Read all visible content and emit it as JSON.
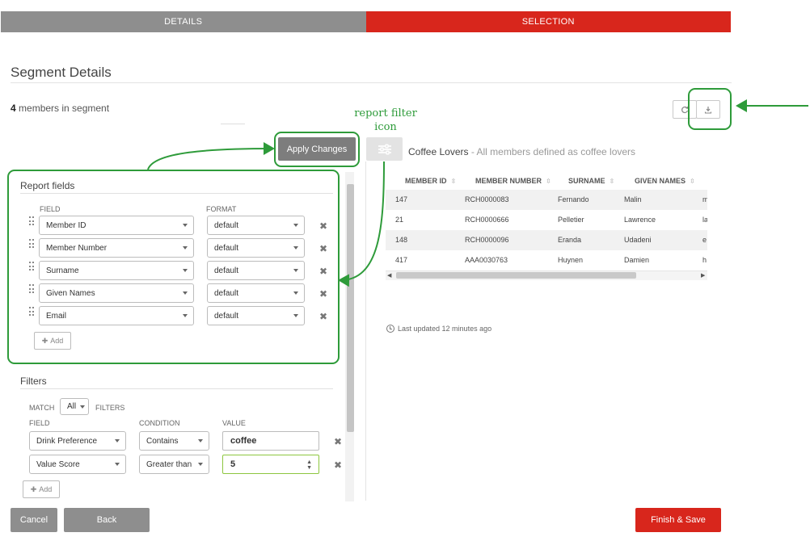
{
  "steps": [
    {
      "label": "DETAILS"
    },
    {
      "label": "SELECTION"
    }
  ],
  "page": {
    "title": "Segment Details",
    "member_count": "4",
    "member_count_suffix": " members in segment"
  },
  "toolbar": {
    "refresh_icon": "refresh-icon",
    "download_icon": "download-icon"
  },
  "apply_button": "Apply Changes",
  "annotation": {
    "line1": "report filter",
    "line2": "icon",
    "color": "#2e9b3a"
  },
  "report_fields": {
    "title": "Report fields",
    "field_header": "FIELD",
    "format_header": "FORMAT",
    "rows": [
      {
        "field": "Member ID",
        "format": "default"
      },
      {
        "field": "Member Number",
        "format": "default"
      },
      {
        "field": "Surname",
        "format": "default"
      },
      {
        "field": "Given Names",
        "format": "default"
      },
      {
        "field": "Email",
        "format": "default"
      }
    ],
    "add_label": "Add"
  },
  "filters": {
    "title": "Filters",
    "match_label": "MATCH",
    "match_value": "All",
    "filters_label": "FILTERS",
    "field_header": "FIELD",
    "condition_header": "CONDITION",
    "value_header": "VALUE",
    "rows": [
      {
        "field": "Drink Preference",
        "condition": "Contains",
        "value": "coffee"
      },
      {
        "field": "Value Score",
        "condition": "Greater than",
        "value": "5"
      }
    ],
    "add_label": "Add"
  },
  "segment": {
    "name": "Coffee Lovers",
    "description": " - All members defined as coffee lovers"
  },
  "table": {
    "headers": [
      "MEMBER ID",
      "MEMBER NUMBER",
      "SURNAME",
      "GIVEN NAMES"
    ],
    "rows": [
      [
        "147",
        "RCH0000083",
        "Fernando",
        "Malin",
        "m"
      ],
      [
        "21",
        "RCH0000666",
        "Pelletier",
        "Lawrence",
        "la"
      ],
      [
        "148",
        "RCH0000096",
        "Eranda",
        "Udadeni",
        "e"
      ],
      [
        "417",
        "AAA0030763",
        "Huynen",
        "Damien",
        "h"
      ]
    ]
  },
  "last_updated": "Last updated 12 minutes ago",
  "footer": {
    "cancel": "Cancel",
    "back": "Back",
    "finish": "Finish & Save"
  },
  "colors": {
    "brand_red": "#d8261c",
    "step_gray": "#8e8e8e",
    "annotation_green": "#2e9b3a"
  }
}
